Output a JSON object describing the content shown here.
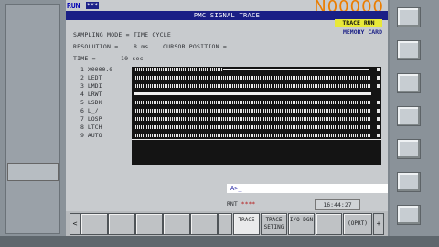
{
  "header": {
    "mode": "RUN",
    "mode_star": "***",
    "program_number": "N00000",
    "title": "PMC SIGNAL TRACE",
    "trace_status": "TRACE RUN",
    "device": "MEMORY CARD"
  },
  "settings": {
    "sampling_mode_label": "SAMPLING MODE = TIME CYCLE",
    "resolution_label": "RESOLUTION =",
    "resolution_value": "8 ms",
    "cursor_position_label": "CURSOR POSITION =",
    "time_label": "TIME =",
    "time_value": "10 sec"
  },
  "signals": [
    "1 X0000.0",
    "2 LEDT",
    "3 LMDI",
    "4 LRWT",
    "5 LSDK",
    "6 L_/",
    "7 LOSP",
    "8 LTCH",
    "9 AUTO"
  ],
  "input_line": "A>_",
  "status": {
    "mode": "RNT",
    "stars": "****",
    "clock": "16:44:27"
  },
  "softkeys": [
    {
      "label": "TRACE",
      "active": true
    },
    {
      "label": "TRACE SETING",
      "active": false
    },
    {
      "label": "I/O DGN",
      "active": false
    },
    {
      "label": "",
      "active": false
    },
    {
      "label": "(OPRT)",
      "active": false
    }
  ],
  "arrows": {
    "left": "<",
    "right": "+"
  }
}
